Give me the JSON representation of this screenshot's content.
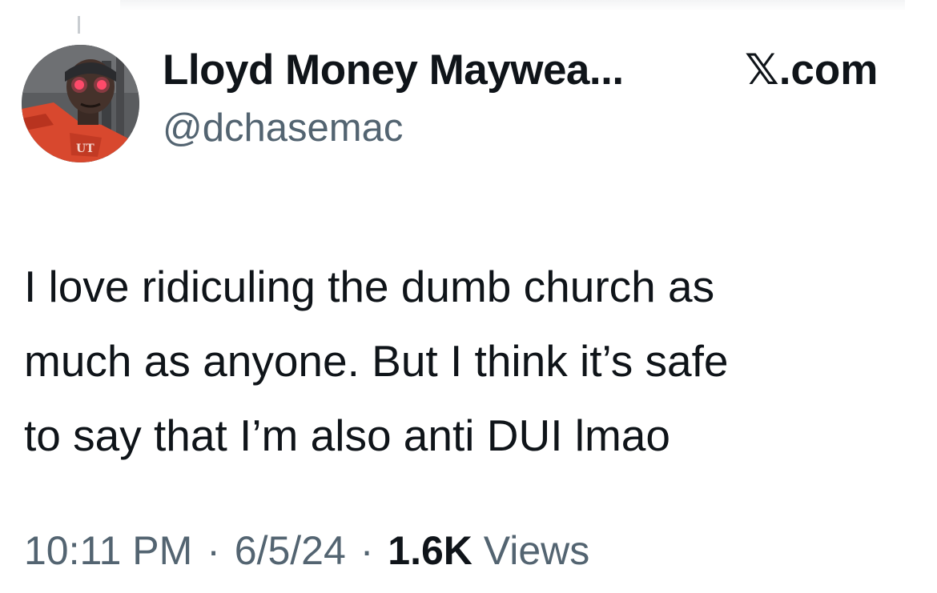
{
  "author": {
    "display_name": "Lloyd Money Maywea...",
    "handle": "@dchasemac",
    "avatar_icon": "player-avatar"
  },
  "source": {
    "label": "𝕏.com"
  },
  "tweet": {
    "lines": [
      "I love ridiculing the dumb church as",
      "much as anyone. But I think it’s safe",
      "to say that I’m also anti DUI lmao"
    ]
  },
  "meta": {
    "time": "10:11 PM",
    "date": "6/5/24",
    "separator": "·",
    "views_count": "1.6K",
    "views_label": "Views"
  },
  "colors": {
    "text": "#0f1419",
    "secondary": "#536471",
    "background": "#ffffff"
  }
}
